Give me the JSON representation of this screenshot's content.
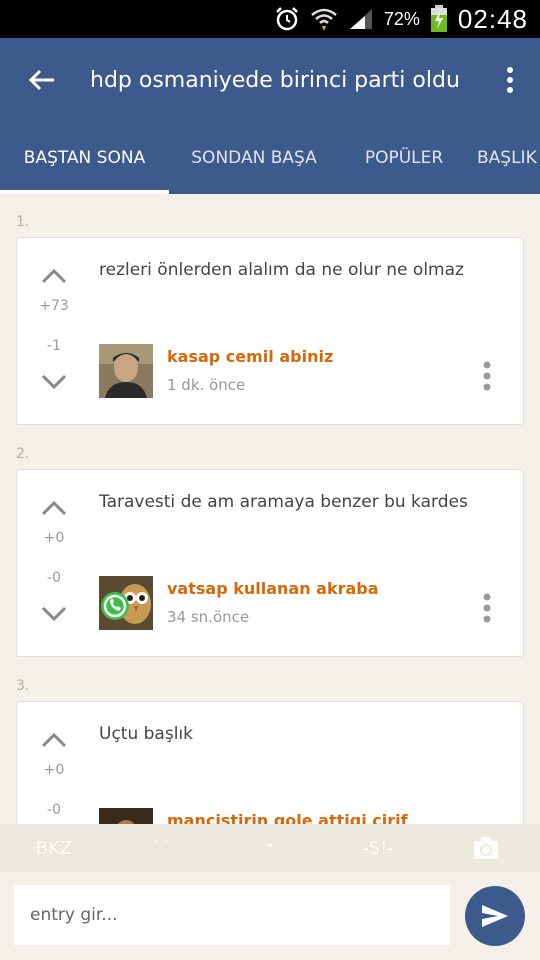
{
  "status_bar": {
    "battery_percent": "72%",
    "time": "02:48",
    "icons": [
      "alarm-icon",
      "wifi-icon",
      "signal-icon",
      "battery-charging-icon"
    ]
  },
  "app_bar": {
    "title": "hdp osmaniyede birinci parti oldu",
    "icons": [
      "back-arrow-icon",
      "more-vert-icon"
    ]
  },
  "tabs": [
    {
      "label": "BAŞTAN SONA",
      "active": true
    },
    {
      "label": "SONDAN BAŞA",
      "active": false
    },
    {
      "label": "POPÜLER",
      "active": false
    },
    {
      "label": "BAŞLIK",
      "active": false
    }
  ],
  "entries": [
    {
      "number": "1.",
      "text": "rezleri önlerden alalım da ne olur ne olmaz",
      "up_count": "+73",
      "down_count": "-1",
      "author": "kasap cemil abiniz",
      "time": "1 dk. önce"
    },
    {
      "number": "2.",
      "text": "Taravesti de am aramaya benzer bu kardes",
      "up_count": "+0",
      "down_count": "-0",
      "author": "vatsap kullanan akraba",
      "time": "34 sn.önce"
    },
    {
      "number": "3.",
      "text": "Uçtu başlık",
      "up_count": "+0",
      "down_count": "-0",
      "author": "mançistirin gole attigi cirif",
      "time": ""
    }
  ],
  "format_bar": {
    "bkz": "BKZ",
    "backtick": "``",
    "star": "*",
    "spoiler": "-S!-",
    "icons": [
      "camera-icon"
    ]
  },
  "input": {
    "placeholder": "entry gir..."
  },
  "colors": {
    "primary": "#3d5a8c",
    "author": "#d8680a",
    "background": "#f2f0e8"
  }
}
